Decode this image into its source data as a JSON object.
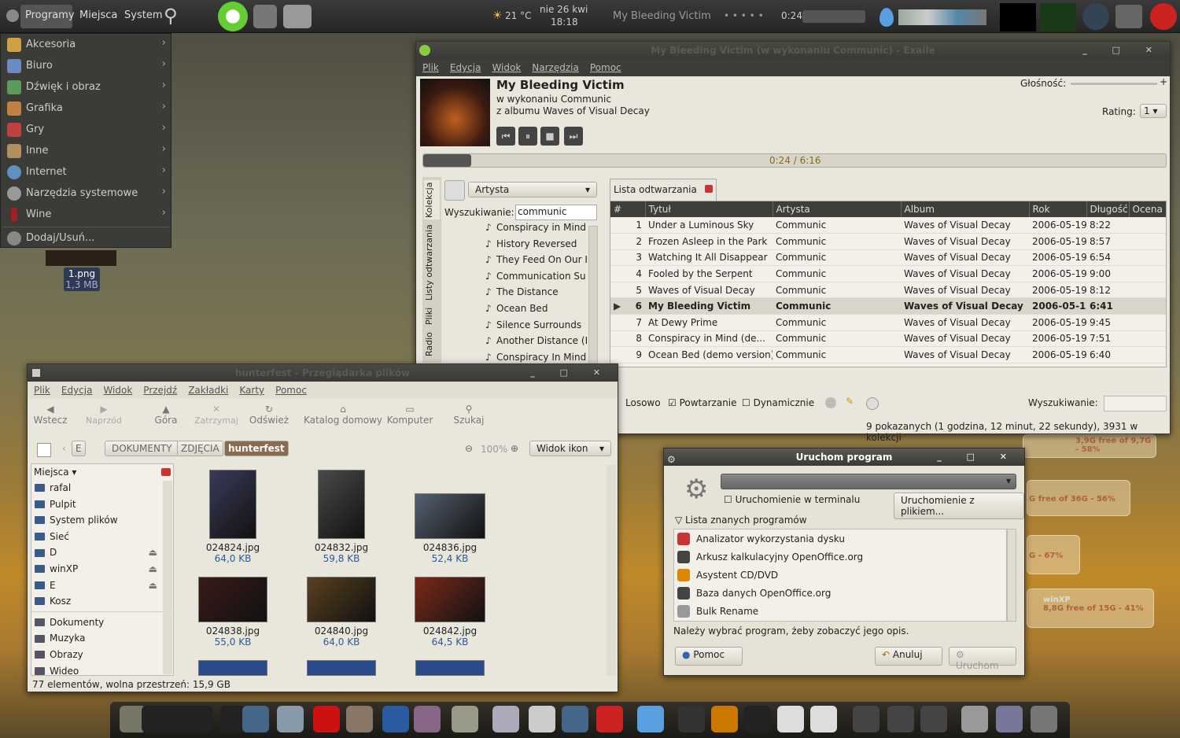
{
  "top_panel": {
    "menus": [
      "Programy",
      "Miejsca",
      "System"
    ],
    "weather": "21 °C",
    "date": "nie 26 kwi",
    "time": "18:18",
    "now_playing": "My Bleeding Victim",
    "rating_dots": "• • • • •",
    "play_time": "0:24"
  },
  "apps_menu": {
    "items": [
      "Akcesoria",
      "Biuro",
      "Dźwięk i obraz",
      "Grafika",
      "Gry",
      "Inne",
      "Internet",
      "Narzędzia systemowe",
      "Wine"
    ],
    "extra": "Dodaj/Usuń..."
  },
  "desktop_file": {
    "name": "1.png",
    "size": "1,3 MB"
  },
  "exaile": {
    "title": "My Bleeding Victim (w wykonaniu Communic) - Exaile",
    "menu": [
      "Plik",
      "Edycja",
      "Widok",
      "Narzędzia",
      "Pomoc"
    ],
    "track": "My Bleeding Victim",
    "artist_line": "w wykonaniu Communic",
    "album_line": "z albumu Waves of Visual Decay",
    "volume_label": "Głośność:",
    "rating_label": "Rating:",
    "rating_value": "1",
    "progress_text": "0:24 / 6:16",
    "progress_fraction": 0.065,
    "side_tabs": [
      "Kolekcja",
      "Listy odtwarzania",
      "Pliki",
      "Radio"
    ],
    "view_select": "Artysta",
    "search_label": "Wyszukiwanie:",
    "search_value": "communic",
    "tree": [
      "Conspiracy in Mind",
      "History Reversed",
      "They Feed On Our I",
      "Communication Su",
      "The Distance",
      "Ocean Bed",
      "Silence Surrounds",
      "Another Distance (I",
      "Conspiracy In Mind"
    ],
    "playlist_tab": "Lista odtwarzania",
    "columns": [
      "#",
      "Tytuł",
      "Artysta",
      "Album",
      "Rok",
      "Długość",
      "Ocena"
    ],
    "rows": [
      [
        "1",
        "Under a Luminous Sky",
        "Communic",
        "Waves of Visual Decay",
        "2006-05-19",
        "8:22"
      ],
      [
        "2",
        "Frozen Asleep in the Park",
        "Communic",
        "Waves of Visual Decay",
        "2006-05-19",
        "8:57"
      ],
      [
        "3",
        "Watching It All Disappear",
        "Communic",
        "Waves of Visual Decay",
        "2006-05-19",
        "6:54"
      ],
      [
        "4",
        "Fooled by the Serpent",
        "Communic",
        "Waves of Visual Decay",
        "2006-05-19",
        "9:00"
      ],
      [
        "5",
        "Waves of Visual Decay",
        "Communic",
        "Waves of Visual Decay",
        "2006-05-19",
        "8:12"
      ],
      [
        "6",
        "My Bleeding Victim",
        "Communic",
        "Waves of Visual Decay",
        "2006-05-1!",
        "6:41"
      ],
      [
        "7",
        "At Dewy Prime",
        "Communic",
        "Waves of Visual Decay",
        "2006-05-19",
        "9:45"
      ],
      [
        "8",
        "Conspiracy in Mind (de...",
        "Communic",
        "Waves of Visual Decay",
        "2006-05-19",
        "7:51"
      ],
      [
        "9",
        "Ocean Bed (demo version)",
        "Communic",
        "Waves of Visual Decay",
        "2006-05-19",
        "6:40"
      ]
    ],
    "current_row": 5,
    "random": "Losowo",
    "repeat": "Powtarzanie",
    "dynamic": "Dynamicznie",
    "search2": "Wyszukiwanie:",
    "status": "9 pokazanych (1 godzina, 12 minut, 22 sekundy), 3931 w kolekcji"
  },
  "nautilus": {
    "title": "hunterfest - Przeglądarka plików",
    "menu": [
      "Plik",
      "Edycja",
      "Widok",
      "Przejdź",
      "Zakładki",
      "Karty",
      "Pomoc"
    ],
    "toolbar": [
      "Wstecz",
      "Naprzód",
      "Góra",
      "Zatrzymaj",
      "Odśwież",
      "Katalog domowy",
      "Komputer",
      "Szukaj"
    ],
    "path": [
      "E",
      "DOKUMENTY",
      "ZDJĘCIA",
      "hunterfest"
    ],
    "zoom": "100%",
    "view": "Widok ikon",
    "places_label": "Miejsca",
    "places": [
      "rafal",
      "Pulpit",
      "System plików",
      "Sieć",
      "D",
      "winXP",
      "E",
      "Kosz"
    ],
    "bookmarks": [
      "Dokumenty",
      "Muzyka",
      "Obrazy",
      "Wideo"
    ],
    "files": [
      [
        "024824.jpg",
        "64,0 KB"
      ],
      [
        "024832.jpg",
        "59,8 KB"
      ],
      [
        "024836.jpg",
        "52,4 KB"
      ],
      [
        "024838.jpg",
        "55,0 KB"
      ],
      [
        "024840.jpg",
        "64,0 KB"
      ],
      [
        "024842.jpg",
        "64,5 KB"
      ]
    ],
    "status": "77 elementów, wolna przestrzeń: 15,9 GB"
  },
  "run_dialog": {
    "title": "Uruchom program",
    "terminal": "Uruchomienie w terminalu",
    "with_file": "Uruchomienie z plikiem...",
    "known": "Lista znanych programów",
    "programs": [
      "Analizator wykorzystania dysku",
      "Arkusz kalkulacyjny OpenOffice.org",
      "Asystent CD/DVD",
      "Baza danych OpenOffice.org",
      "Bulk Rename"
    ],
    "hint": "Należy wybrać program, żeby zobaczyć jego opis.",
    "help": "Pomoc",
    "cancel": "Anuluj",
    "run": "Uruchom"
  },
  "gauges": [
    {
      "text": "3,9G free of 9,7G - 58%",
      "fraction": 0.58
    },
    {
      "text": "G free of 36G - 56%",
      "fraction": 0.56
    },
    {
      "text": "G - 67%",
      "fraction": 0.67
    },
    {
      "name": "winXP",
      "text": "8,8G free of 15G - 41%",
      "fraction": 0.41
    }
  ]
}
